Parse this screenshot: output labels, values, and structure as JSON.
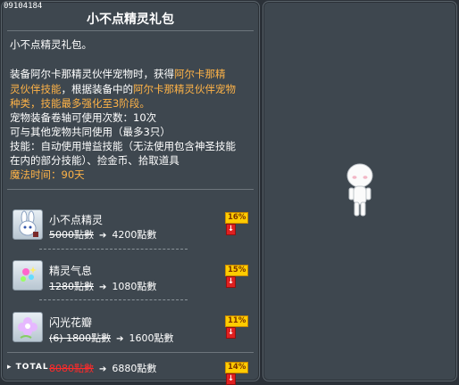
{
  "header": {
    "item_code": "09104184",
    "title": "小不点精灵礼包"
  },
  "description": {
    "name_line": "小不点精灵礼包。",
    "para1_a": " 装备阿尔卡那精灵伙伴宠物时，获得",
    "para1_b": "阿尔卡那精",
    "para2_a": "灵伙伴技能",
    "para2_b": "，根据装备中的",
    "para2_c": "阿尔卡那精灵伙伴宠物",
    "para3": "种类，技能最多强化至3阶段。",
    "line4": "宠物装备卷轴可使用次数：10次",
    "line5": "可与其他宠物共同使用（最多3只）",
    "line6": "技能：自动使用增益技能（无法使用包含神圣技能",
    "line7": "在内的部分技能）、捡金币、拾取道具",
    "magic_time": "魔法时间：90天"
  },
  "items": [
    {
      "name": "小不点精灵",
      "icon": "rabbit-pet-icon",
      "old_price": "5000點數",
      "new_price": "4200點數",
      "discount": "16%"
    },
    {
      "name": "精灵气息",
      "icon": "sparkle-aura-icon",
      "old_price": "1280點數",
      "new_price": "1080點數",
      "discount": "15%"
    },
    {
      "name": "闪光花瓣",
      "icon": "flower-petal-icon",
      "old_price": "(6) 1800點數",
      "new_price": "1600點數",
      "discount": "11%"
    }
  ],
  "total": {
    "label": "TOTAL",
    "old_price": "8080點數",
    "new_price": "6880點數",
    "discount": "14%"
  },
  "preview": {
    "character": "avatar-preview"
  },
  "colors": {
    "panel_bg": "#3e474f",
    "highlight": "#ffb347",
    "badge_yellow": "#ffcc00",
    "badge_red": "#e02020"
  }
}
